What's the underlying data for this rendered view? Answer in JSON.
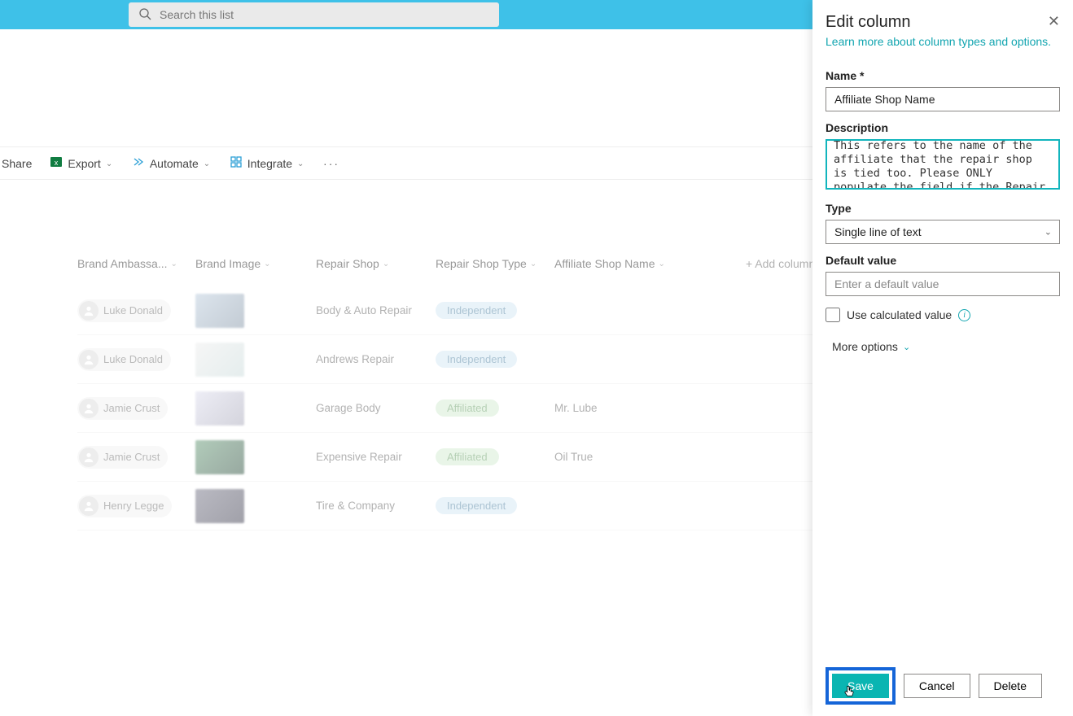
{
  "search": {
    "placeholder": "Search this list"
  },
  "commands": {
    "share": "Share",
    "export": "Export",
    "automate": "Automate",
    "integrate": "Integrate"
  },
  "columns": {
    "ambassador": "Brand Ambassa...",
    "image": "Brand Image",
    "repair_shop": "Repair Shop",
    "repair_type": "Repair Shop Type",
    "affiliate_name": "Affiliate Shop Name",
    "add": "+  Add column"
  },
  "rows": [
    {
      "ambassador": "Luke Donald",
      "shop": "Body & Auto Repair",
      "type": "Independent",
      "type_class": "pill-ind",
      "affiliate": ""
    },
    {
      "ambassador": "Luke Donald",
      "shop": "Andrews Repair",
      "type": "Independent",
      "type_class": "pill-ind",
      "affiliate": ""
    },
    {
      "ambassador": "Jamie Crust",
      "shop": "Garage Body",
      "type": "Affiliated",
      "type_class": "pill-aff",
      "affiliate": "Mr. Lube"
    },
    {
      "ambassador": "Jamie Crust",
      "shop": "Expensive Repair",
      "type": "Affiliated",
      "type_class": "pill-aff",
      "affiliate": "Oil True"
    },
    {
      "ambassador": "Henry Legge",
      "shop": "Tire & Company",
      "type": "Independent",
      "type_class": "pill-ind",
      "affiliate": ""
    }
  ],
  "panel": {
    "title": "Edit column",
    "learn_more": "Learn more about column types and options.",
    "name_label": "Name *",
    "name_value": "Affiliate Shop Name",
    "desc_label": "Description",
    "desc_value": "This refers to the name of the affiliate that the repair shop is tied too. Please ONLY populate the field if the Repair Shop Type is \"Affiliate\"",
    "type_label": "Type",
    "type_value": "Single line of text",
    "default_label": "Default value",
    "default_placeholder": "Enter a default value",
    "calc_label": "Use calculated value",
    "more_options": "More options",
    "save": "Save",
    "cancel": "Cancel",
    "delete": "Delete"
  }
}
